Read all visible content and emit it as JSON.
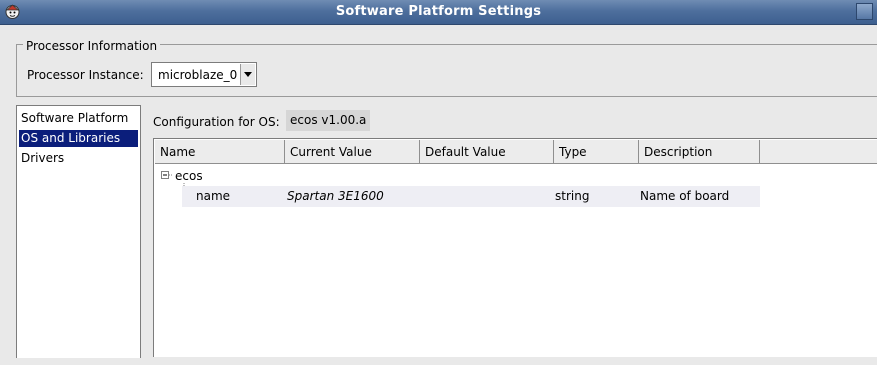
{
  "window": {
    "title": "Software Platform Settings"
  },
  "processor_info": {
    "group_label": "Processor Information",
    "instance_label": "Processor Instance:",
    "instance_value": "microblaze_0"
  },
  "nav": {
    "items": [
      {
        "label": "Software Platform",
        "selected": false
      },
      {
        "label": "OS and Libraries",
        "selected": true
      },
      {
        "label": "Drivers",
        "selected": false
      }
    ]
  },
  "config": {
    "label": "Configuration for OS:",
    "value": "ecos v1.00.a"
  },
  "table": {
    "columns": [
      "Name",
      "Current Value",
      "Default Value",
      "Type",
      "Description"
    ],
    "tree": {
      "root": "ecos",
      "rows": [
        {
          "name": "name",
          "current_value": "Spartan 3E1600",
          "default_value": "",
          "type": "string",
          "description": "Name of board"
        }
      ]
    }
  },
  "colors": {
    "titlebar": "#4e6f9d",
    "selection": "#0b1e7b",
    "background": "#e9e9e9"
  }
}
